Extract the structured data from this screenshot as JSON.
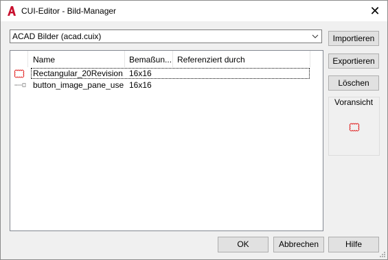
{
  "window": {
    "title": "CUI-Editor - Bild-Manager",
    "close_glyph": "✕"
  },
  "dropdown": {
    "selected": "ACAD Bilder (acad.cuix)"
  },
  "list": {
    "columns": [
      "Name",
      "Bemaßun...",
      "Referenziert durch"
    ],
    "rows": [
      {
        "icon": "rectangular-revision-cloud-icon",
        "name": "Rectangular_20Revision...",
        "size": "16x16",
        "ref": ""
      },
      {
        "icon": "button-image-pane-icon",
        "name": "button_image_pane_use...",
        "size": "16x16",
        "ref": ""
      }
    ]
  },
  "buttons": {
    "import": "Importieren",
    "export": "Exportieren",
    "delete": "Löschen",
    "ok": "OK",
    "cancel": "Abbrechen",
    "help": "Hilfe"
  },
  "preview": {
    "label": "Voransicht",
    "icon": "rectangular-revision-cloud-icon"
  },
  "colors": {
    "app_icon": "#c8102e",
    "cloud": "#e02020"
  }
}
